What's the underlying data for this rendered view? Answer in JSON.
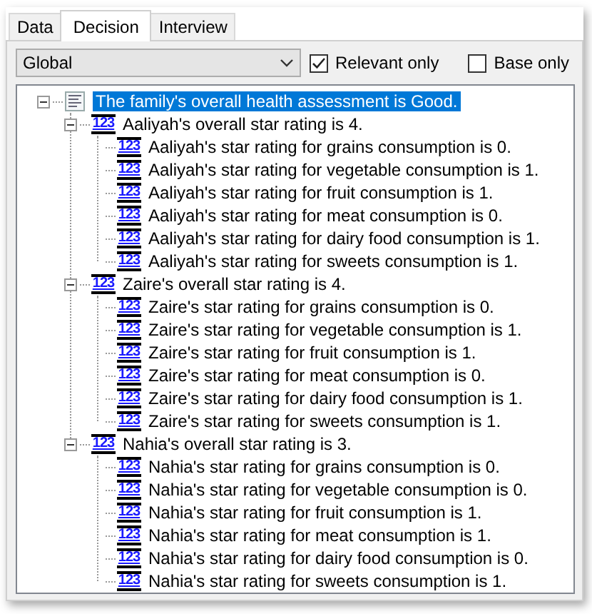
{
  "tabs": [
    {
      "label": "Data",
      "selected": false
    },
    {
      "label": "Decision",
      "selected": true
    },
    {
      "label": "Interview",
      "selected": false
    }
  ],
  "scope_dropdown": {
    "value": "Global"
  },
  "checkboxes": [
    {
      "label": "Relevant only",
      "checked": true
    },
    {
      "label": "Base only",
      "checked": false
    }
  ],
  "tree": [
    {
      "kind": "text",
      "label": "The family's overall health assessment is Good.",
      "selected": true,
      "expanded": true,
      "children": [
        {
          "kind": "number",
          "badge": "123",
          "label": "Aaliyah's overall star rating is 4.",
          "selected": false,
          "expanded": true,
          "children": [
            {
              "kind": "number",
              "badge": "123",
              "label": "Aaliyah's star rating for grains consumption is 0.",
              "selected": false
            },
            {
              "kind": "number",
              "badge": "123",
              "label": "Aaliyah's star rating for vegetable consumption is 1.",
              "selected": false
            },
            {
              "kind": "number",
              "badge": "123",
              "label": "Aaliyah's star rating for fruit consumption is 1.",
              "selected": false
            },
            {
              "kind": "number",
              "badge": "123",
              "label": "Aaliyah's star rating for meat consumption is 0.",
              "selected": false
            },
            {
              "kind": "number",
              "badge": "123",
              "label": "Aaliyah's star rating for dairy food consumption is 1.",
              "selected": false
            },
            {
              "kind": "number",
              "badge": "123",
              "label": "Aaliyah's star rating for sweets consumption is 1.",
              "selected": false
            }
          ]
        },
        {
          "kind": "number",
          "badge": "123",
          "label": "Zaire's overall star rating is 4.",
          "selected": false,
          "expanded": true,
          "children": [
            {
              "kind": "number",
              "badge": "123",
              "label": "Zaire's star rating for grains consumption is 0.",
              "selected": false
            },
            {
              "kind": "number",
              "badge": "123",
              "label": "Zaire's star rating for vegetable consumption is 1.",
              "selected": false
            },
            {
              "kind": "number",
              "badge": "123",
              "label": "Zaire's star rating for fruit consumption is 1.",
              "selected": false
            },
            {
              "kind": "number",
              "badge": "123",
              "label": "Zaire's star rating for meat consumption is 0.",
              "selected": false
            },
            {
              "kind": "number",
              "badge": "123",
              "label": "Zaire's star rating for dairy food consumption is 1.",
              "selected": false
            },
            {
              "kind": "number",
              "badge": "123",
              "label": "Zaire's star rating for sweets consumption is 1.",
              "selected": false
            }
          ]
        },
        {
          "kind": "number",
          "badge": "123",
          "label": "Nahia's overall star rating is 3.",
          "selected": false,
          "expanded": true,
          "children": [
            {
              "kind": "number",
              "badge": "123",
              "label": "Nahia's star rating for grains consumption is 0.",
              "selected": false
            },
            {
              "kind": "number",
              "badge": "123",
              "label": "Nahia's star rating for vegetable consumption is 0.",
              "selected": false
            },
            {
              "kind": "number",
              "badge": "123",
              "label": "Nahia's star rating for fruit consumption is 1.",
              "selected": false
            },
            {
              "kind": "number",
              "badge": "123",
              "label": "Nahia's star rating for meat consumption is 1.",
              "selected": false
            },
            {
              "kind": "number",
              "badge": "123",
              "label": "Nahia's star rating for dairy food consumption is 0.",
              "selected": false
            },
            {
              "kind": "number",
              "badge": "123",
              "label": "Nahia's star rating for sweets consumption is 1.",
              "selected": false
            }
          ]
        }
      ]
    }
  ]
}
